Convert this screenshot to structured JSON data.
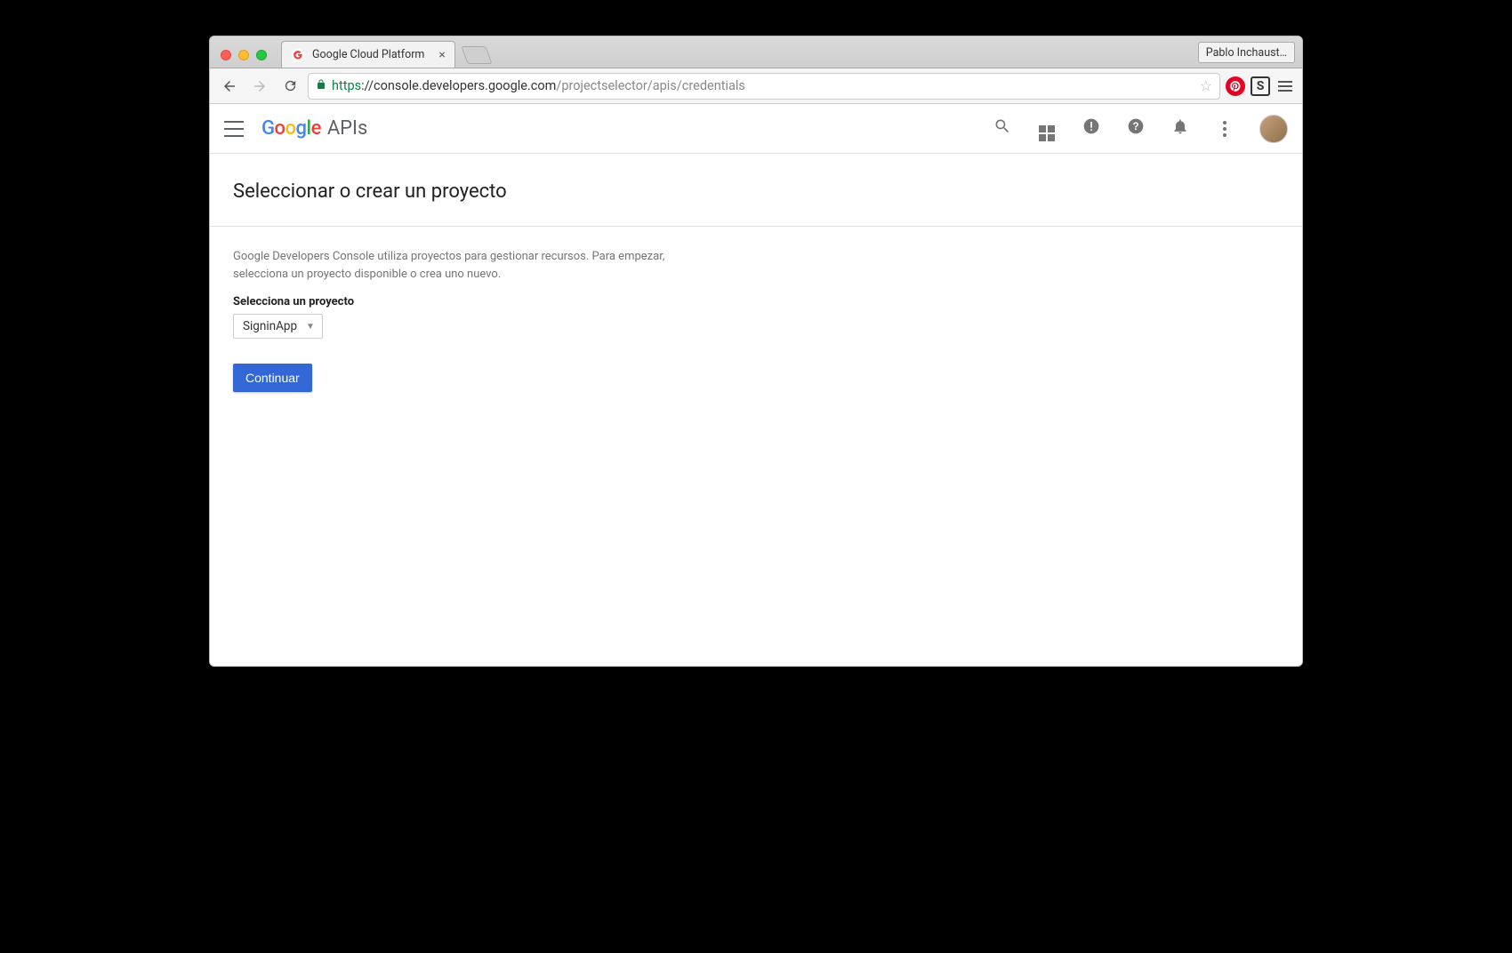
{
  "browser": {
    "tab_title": "Google Cloud Platform",
    "profile_name": "Pablo Inchaust…",
    "url_scheme": "https",
    "url_host": "://console.developers.google.com",
    "url_path": "/projectselector/apis/credentials"
  },
  "header": {
    "logo_suffix": "APIs"
  },
  "page": {
    "title": "Seleccionar o crear un proyecto",
    "description": "Google Developers Console utiliza proyectos para gestionar recursos. Para empezar, selecciona un proyecto disponible o crea uno nuevo.",
    "field_label": "Selecciona un proyecto",
    "selected_project": "SigninApp",
    "continue_label": "Continuar"
  }
}
